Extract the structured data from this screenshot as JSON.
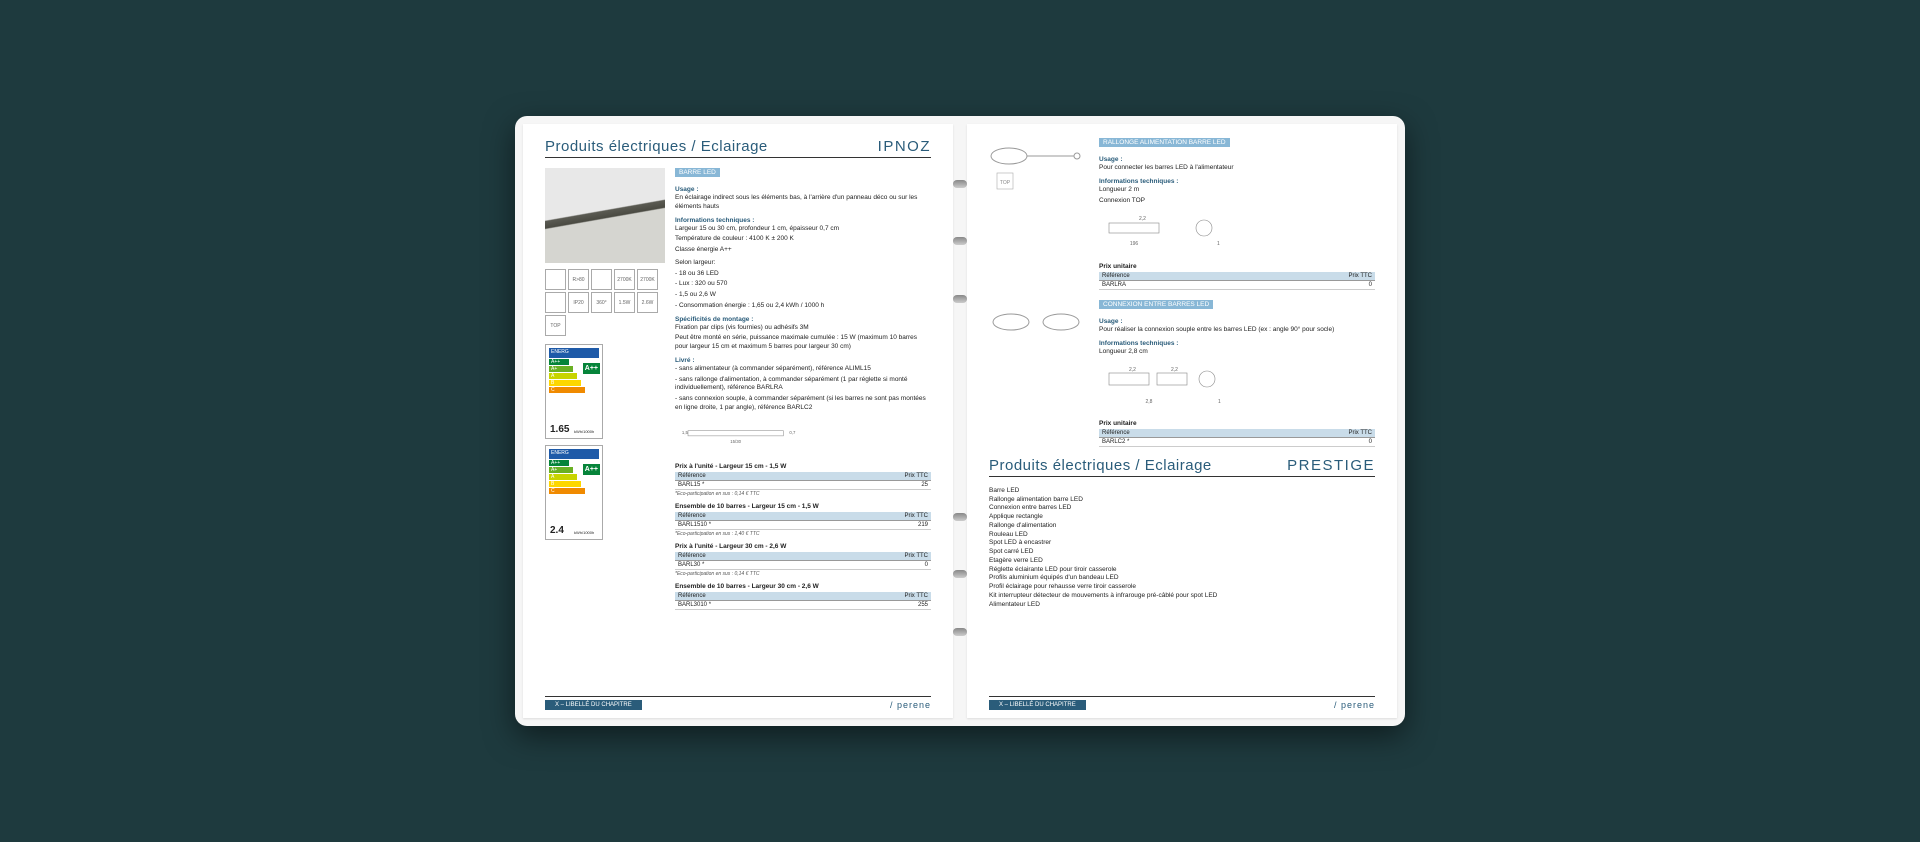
{
  "left": {
    "title": "Produits électriques / Eclairage",
    "brand": "IPNOZ",
    "product": {
      "name": "BARRE LED",
      "usage_label": "Usage :",
      "usage_text": "En éclairage indirect sous les éléments bas, à l'arrière d'un panneau déco ou sur les éléments hauts",
      "tech_label": "Informations techniques :",
      "tech_1": "Largeur 15 ou 30 cm, profondeur 1 cm, épaisseur 0,7 cm",
      "tech_2": "Température de couleur : 4100 K ± 200 K",
      "tech_3": "Classe énergie A++",
      "width_label": "Selon largeur:",
      "width_1": "- 18 ou 36 LED",
      "width_2": "- Lux : 320 ou 570",
      "width_3": "- 1,5 ou 2,6 W",
      "width_4": "- Consommation énergie : 1,65 ou 2,4 kWh / 1000 h",
      "mount_label": "Spécificités de montage :",
      "mount_1": "Fixation par clips (vis fournies) ou adhésifs 3M",
      "mount_2": "Peut être monté en série, puissance maximale cumulée : 15 W (maximum 10 barres pour largeur 15 cm et maximum 5 barres pour largeur 30 cm)",
      "deliv_label": "Livré :",
      "deliv_1": "- sans alimentateur (à commander séparément), référence ALIML15",
      "deliv_2": "- sans rallonge d'alimentation, à commander séparément (1 par réglette si monté individuellement), référence BARLRA",
      "deliv_3": "- sans connexion souple, à commander séparément (si les barres ne sont pas montées en ligne droite, 1 par angle), référence BARLC2",
      "tables": [
        {
          "title": "Prix à l'unité - Largeur 15 cm - 1,5 W",
          "ref": "BARL15 *",
          "price": "25",
          "eco": "*Eco-participation en sus : 0,14 € TTC"
        },
        {
          "title": "Ensemble de 10 barres - Largeur 15 cm - 1,5 W",
          "ref": "BARL1510 *",
          "price": "219",
          "eco": "*Eco-participation en sus : 1,40 € TTC"
        },
        {
          "title": "Prix à l'unité - Largeur 30 cm - 2,6 W",
          "ref": "BARL30 *",
          "price": "0",
          "eco": "*Eco-participation en sus : 0,14 € TTC"
        },
        {
          "title": "Ensemble de 10 barres - Largeur 30 cm - 2,6 W",
          "ref": "BARL3010 *",
          "price": "255",
          "eco": ""
        }
      ],
      "col_ref": "Référence",
      "col_price": "Prix TTC"
    },
    "icons": [
      "",
      "R>80",
      "",
      "2700K",
      "2700K",
      "",
      "IP20",
      "360°",
      "1.5W",
      "2.6W",
      "TOP"
    ],
    "energy": [
      {
        "rating": "A++",
        "big": "1.65",
        "unit": "kWh/1000h"
      },
      {
        "rating": "A++",
        "big": "2.4",
        "unit": "kWh/1000h"
      }
    ],
    "chapter": "X – LIBELLÉ DU CHAPITRE",
    "perene": "/ perene"
  },
  "right": {
    "products": [
      {
        "name": "RALLONGE ALIMENTATION BARRE LED",
        "usage_label": "Usage :",
        "usage_text": "Pour connecter les barres LED à l'alimentateur",
        "tech_label": "Informations techniques :",
        "tech_1": "Longueur 2 m",
        "tech_2": "Connexion TOP",
        "price_title": "Prix unitaire",
        "col_ref": "Référence",
        "col_price": "Prix TTC",
        "ref": "BARLRA",
        "price": "0"
      },
      {
        "name": "CONNEXION ENTRE BARRES LED",
        "usage_label": "Usage :",
        "usage_text": "Pour réaliser la connexion souple entre les barres LED (ex : angle 90° pour socle)",
        "tech_label": "Informations techniques :",
        "tech_1": "Longueur 2,8 cm",
        "price_title": "Prix unitaire",
        "col_ref": "Référence",
        "col_price": "Prix TTC",
        "ref": "BARLC2 *",
        "price": "0"
      }
    ],
    "section2": {
      "title": "Produits électriques / Eclairage",
      "brand": "PRESTIGE",
      "items": [
        "Barre LED",
        "Rallonge alimentation barre LED",
        "Connexion entre barres LED",
        "Applique rectangle",
        "Rallonge d'alimentation",
        "Rouleau LED",
        "Spot LED à encastrer",
        "Spot carré LED",
        "Etagère verre LED",
        "Réglette éclairante LED pour tiroir casserole",
        "Profils aluminium équipés d'un bandeau LED",
        "Profil éclairage pour rehausse verre tiroir casserole",
        "Kit interrupteur détecteur de mouvements à infrarouge pré-câblé pour spot LED",
        "Alimentateur LED"
      ]
    },
    "chapter": "X – LIBELLÉ DU CHAPITRE",
    "perene": "/ perene"
  }
}
